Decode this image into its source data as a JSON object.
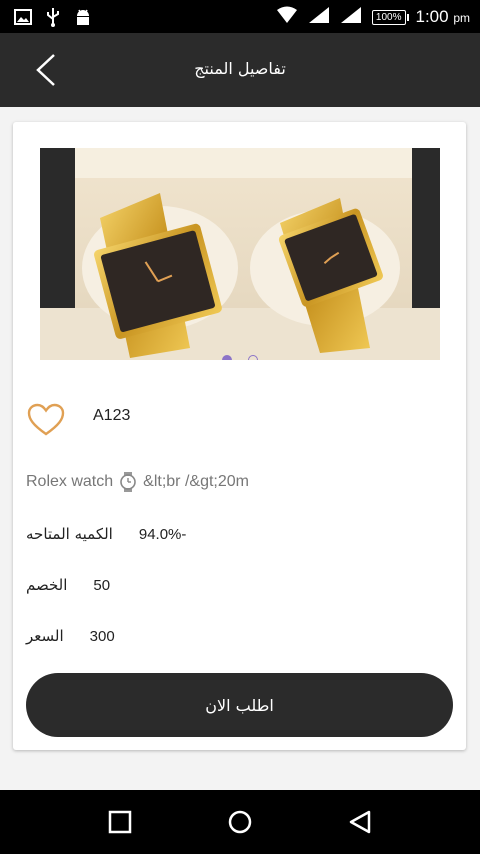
{
  "status_bar": {
    "time": "1:00",
    "ampm": "pm",
    "battery": "100%"
  },
  "header": {
    "title": "تفاصيل المنتج"
  },
  "product": {
    "image_pager": {
      "count": 2,
      "active_index": 0
    },
    "code": "A123",
    "description": "Rolex watch",
    "description_extra": "&lt;br /&gt;20m",
    "available_quantity": {
      "label": "الكميه المتاحه",
      "value": "94.0%-"
    },
    "discount": {
      "label": "الخصم",
      "value": "50"
    },
    "price": {
      "label": "السعر",
      "value": "300"
    }
  },
  "order_button": {
    "label": "اطلب الان"
  },
  "colors": {
    "header": "#2b2b2b",
    "accent": "#e0a054",
    "pager": "#8c74c8"
  }
}
